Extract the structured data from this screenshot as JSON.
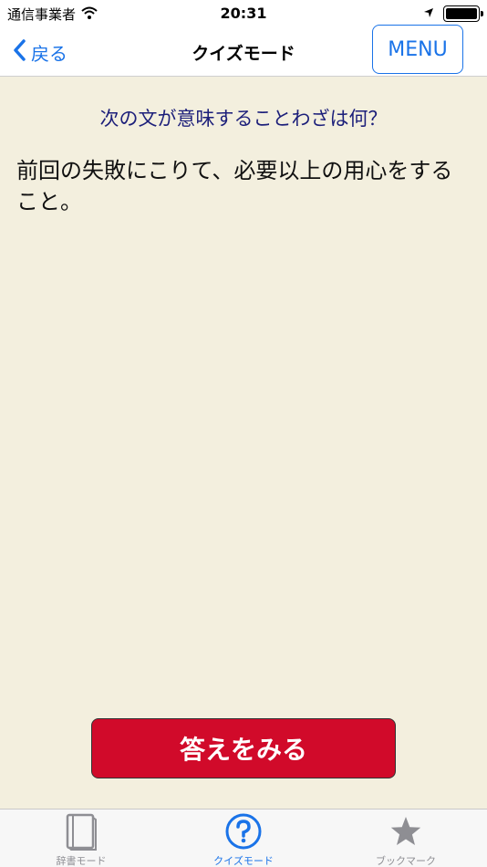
{
  "status_bar": {
    "carrier": "通信事業者",
    "time": "20:31"
  },
  "nav": {
    "back_label": "戻る",
    "title": "クイズモード",
    "menu_label": "MENU"
  },
  "quiz": {
    "question": "次の文が意味することわざは何？",
    "definition": "前回の失敗にこりて、必要以上の用心をすること。",
    "answer_button": "答えをみる"
  },
  "tabs": [
    {
      "label": "辞書モード",
      "icon": "book-icon",
      "active": false
    },
    {
      "label": "クイズモード",
      "icon": "question-circle-icon",
      "active": true
    },
    {
      "label": "ブックマーク",
      "icon": "star-icon",
      "active": false
    }
  ],
  "colors": {
    "accent": "#1a73e8",
    "content_bg": "#f3efde",
    "question_text": "#1c1f7a",
    "answer_button": "#d10a2a"
  }
}
